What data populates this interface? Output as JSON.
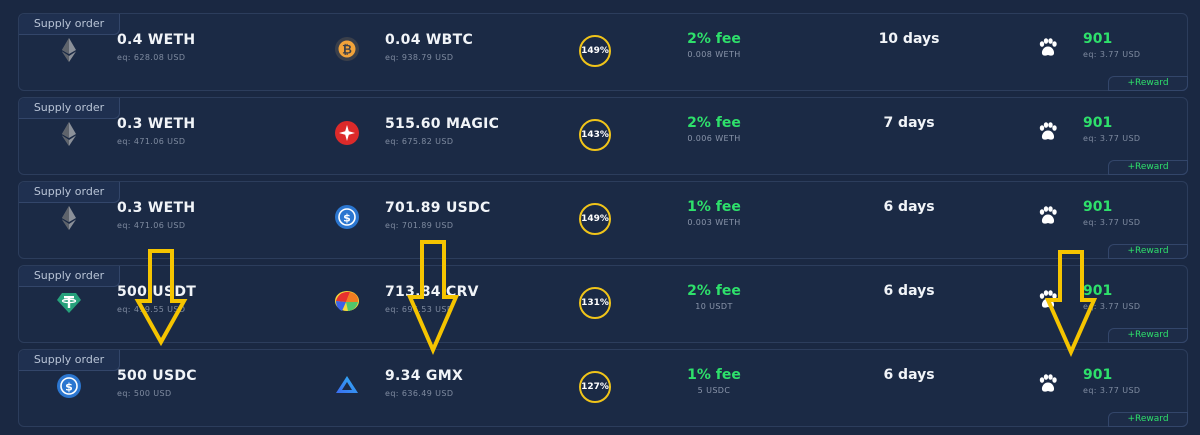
{
  "rows": [
    {
      "tag": "Supply order",
      "left": {
        "icon": "eth-icon",
        "amount": "0.4 WETH",
        "eq": "eq: 628.08 USD"
      },
      "right": {
        "icon": "wbtc-icon",
        "amount": "0.04 WBTC",
        "eq": "eq: 938.79 USD"
      },
      "apr": "149%",
      "fee": "2% fee",
      "fee_sub": "0.008 WETH",
      "days": "10 days",
      "points": "901",
      "points_sub": "eq: 3.77 USD",
      "reward": "+Reward"
    },
    {
      "tag": "Supply order",
      "left": {
        "icon": "eth-icon",
        "amount": "0.3 WETH",
        "eq": "eq: 471.06 USD"
      },
      "right": {
        "icon": "magic-icon",
        "amount": "515.60 MAGIC",
        "eq": "eq: 675.82 USD"
      },
      "apr": "143%",
      "fee": "2% fee",
      "fee_sub": "0.006 WETH",
      "days": "7 days",
      "points": "901",
      "points_sub": "eq: 3.77 USD",
      "reward": "+Reward"
    },
    {
      "tag": "Supply order",
      "left": {
        "icon": "eth-icon",
        "amount": "0.3 WETH",
        "eq": "eq: 471.06 USD"
      },
      "right": {
        "icon": "usdc-icon",
        "amount": "701.89 USDC",
        "eq": "eq: 701.89 USD"
      },
      "apr": "149%",
      "fee": "1% fee",
      "fee_sub": "0.003 WETH",
      "days": "6 days",
      "points": "901",
      "points_sub": "eq: 3.77 USD",
      "reward": "+Reward"
    },
    {
      "tag": "Supply order",
      "left": {
        "icon": "usdt-icon",
        "amount": "500 USDT",
        "eq": "eq: 499.55 USD"
      },
      "right": {
        "icon": "crv-icon",
        "amount": "713.84 CRV",
        "eq": "eq: 696.53 USD"
      },
      "apr": "131%",
      "fee": "2% fee",
      "fee_sub": "10 USDT",
      "days": "6 days",
      "points": "901",
      "points_sub": "eq: 3.77 USD",
      "reward": "+Reward"
    },
    {
      "tag": "Supply order",
      "left": {
        "icon": "usdc-icon",
        "amount": "500 USDC",
        "eq": "eq: 500 USD"
      },
      "right": {
        "icon": "gmx-icon",
        "amount": "9.34 GMX",
        "eq": "eq: 636.49 USD"
      },
      "apr": "127%",
      "fee": "1% fee",
      "fee_sub": "5 USDC",
      "days": "6 days",
      "points": "901",
      "points_sub": "eq: 3.77 USD",
      "reward": "+Reward"
    }
  ],
  "colors": {
    "accent_green": "#2ee06b",
    "apr_ring": "#f0c419",
    "arrow_yellow": "#f5c400"
  }
}
